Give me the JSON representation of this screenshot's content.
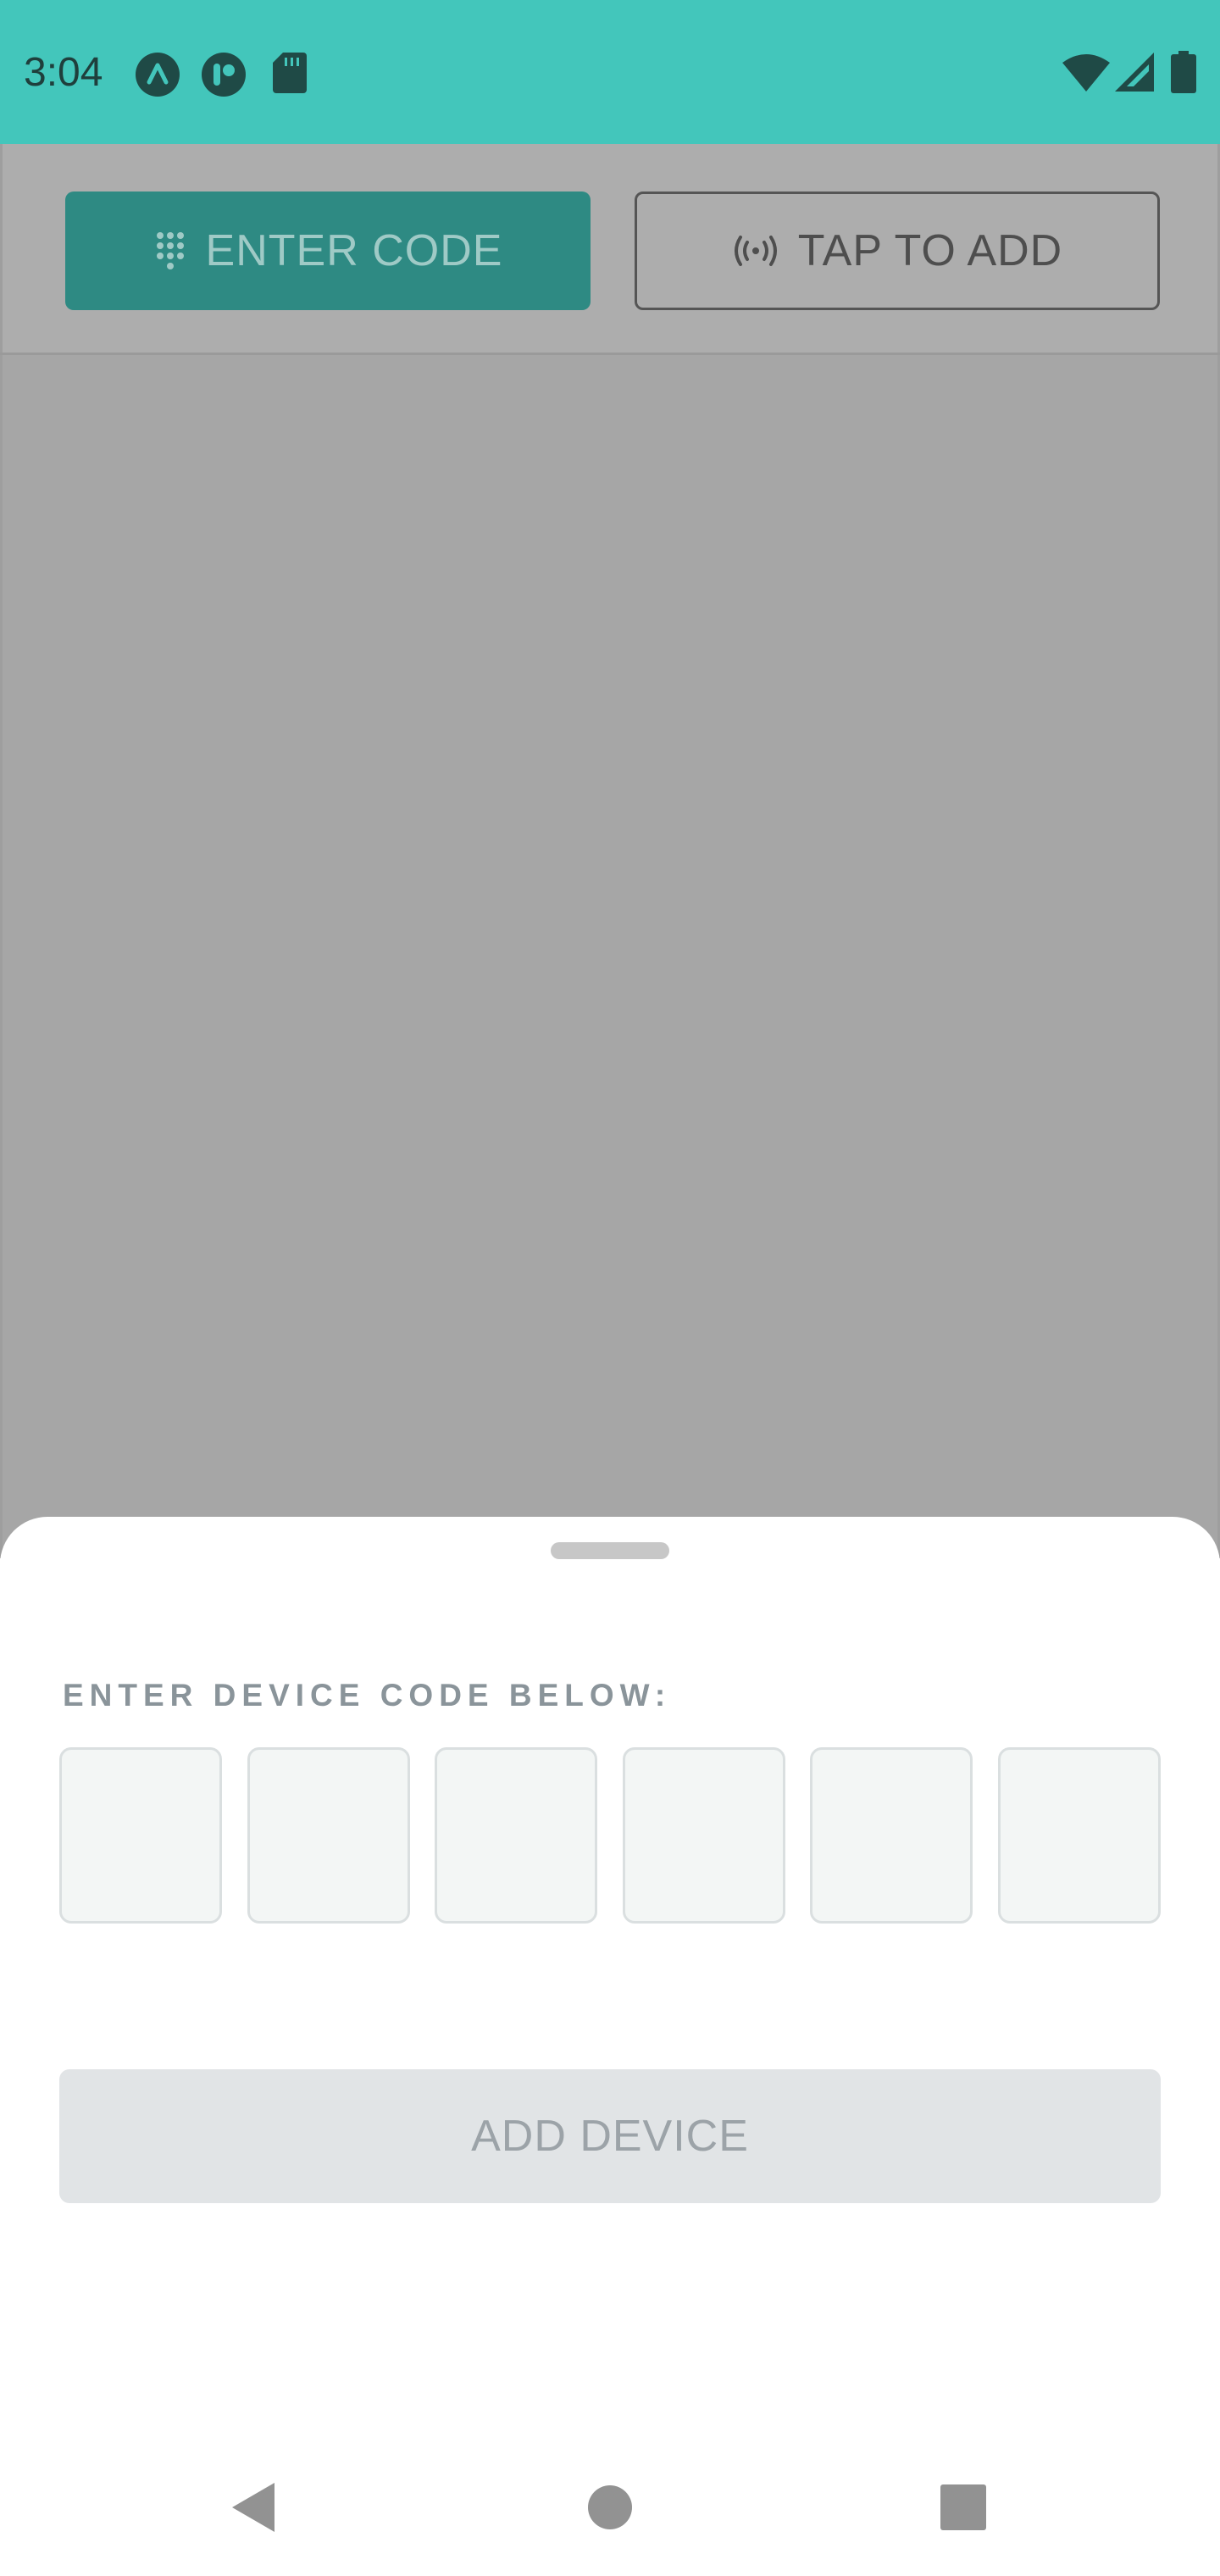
{
  "status_bar": {
    "time": "3:04",
    "left_icons": [
      "app-a-icon",
      "app-b-icon",
      "sd-card-icon"
    ],
    "right_icons": [
      "wifi-icon",
      "cell-signal-icon",
      "battery-icon"
    ]
  },
  "tabs": [
    {
      "label": "ENTER CODE",
      "icon": "keypad-icon",
      "active": true
    },
    {
      "label": "TAP TO ADD",
      "icon": "nfc-broadcast-icon",
      "active": false
    }
  ],
  "sheet": {
    "label": "ENTER DEVICE CODE BELOW:",
    "code_boxes": [
      "",
      "",
      "",
      "",
      "",
      ""
    ],
    "submit_label": "ADD DEVICE",
    "submit_enabled": false
  },
  "nav_bar": {
    "buttons": [
      "back-icon",
      "home-icon",
      "recents-icon"
    ]
  },
  "colors": {
    "status_bar": "#43C6BB",
    "active_tab": "#2E8A83",
    "scrim": "#A6A6A6",
    "disabled_button": "#E1E4E6"
  }
}
